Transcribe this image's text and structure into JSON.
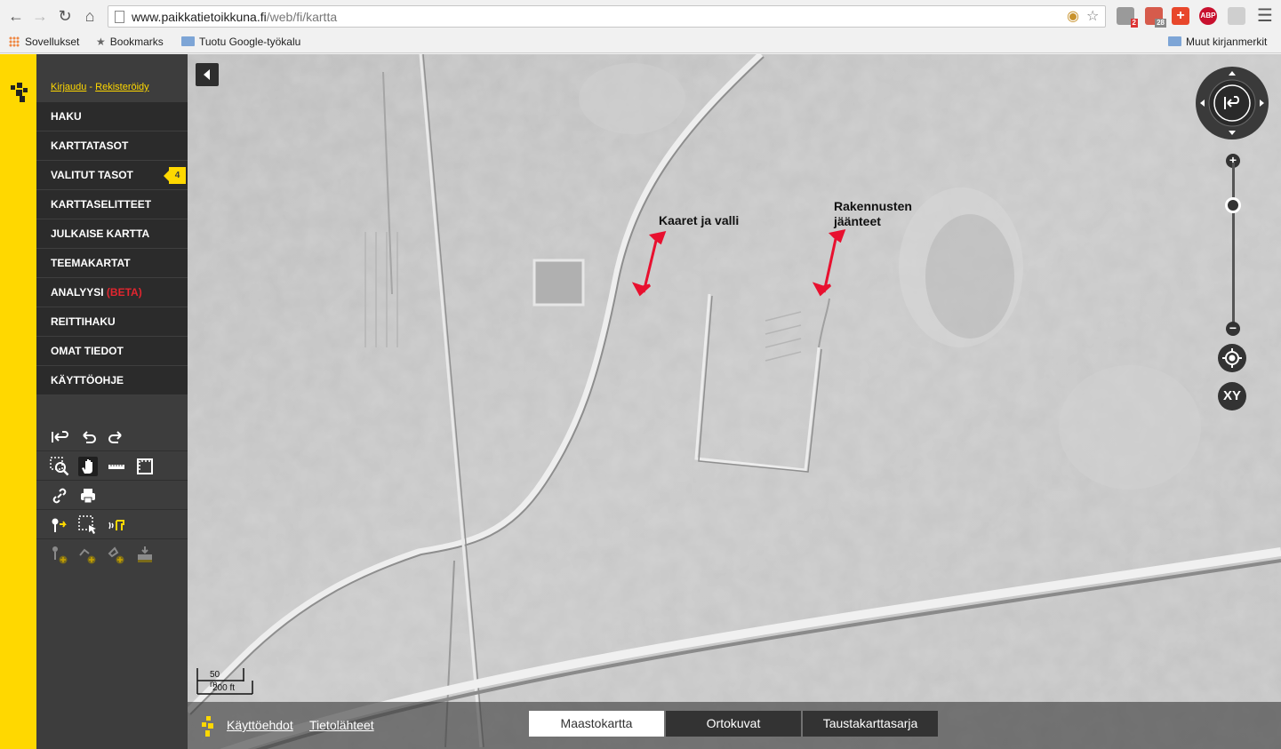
{
  "browser": {
    "url_domain": "www.paikkatietoikkuna.fi",
    "url_path": "/web/fi/kartta",
    "icons": [
      "back-arrow-icon",
      "forward-arrow-icon",
      "reload-icon",
      "home-icon",
      "star-icon",
      "menu-icon"
    ],
    "extensions": {
      "badge_2": "2",
      "badge_28": "28",
      "abp_label": "ABP",
      "plus_label": "+"
    },
    "bookmarks": {
      "apps": "Sovellukset",
      "bookmarks": "Bookmarks",
      "import": "Tuotu Google-työkalu",
      "other": "Muut kirjanmerkit"
    }
  },
  "sidebar": {
    "login": "Kirjaudu",
    "separator": "-",
    "register": "Rekisteröidy",
    "menu": [
      {
        "label": "HAKU"
      },
      {
        "label": "KARTTATASOT"
      },
      {
        "label": "VALITUT TASOT",
        "badge": "4"
      },
      {
        "label": "KARTTASELITTEET"
      },
      {
        "label": "JULKAISE KARTTA"
      },
      {
        "label": "TEEMAKARTAT"
      },
      {
        "label": "ANALYYSI",
        "suffix": "(BETA)"
      },
      {
        "label": "REITTIHAKU"
      },
      {
        "label": "OMAT TIEDOT"
      },
      {
        "label": "KÄYTTÖOHJE"
      }
    ]
  },
  "map": {
    "annotations": {
      "left": "Kaaret ja valli",
      "right_line1": "Rakennusten",
      "right_line2": "jäänteet"
    },
    "arrow_color": "#e8102f",
    "scale": {
      "metric": "50 m",
      "imperial": "200 ft"
    },
    "xy_label": "XY",
    "zoom": {
      "plus": "+",
      "minus": "−"
    },
    "footer": {
      "terms": "Käyttöehdot",
      "sources": "Tietolähteet",
      "tabs": [
        {
          "label": "Maastokartta",
          "active": true
        },
        {
          "label": "Ortokuvat",
          "active": false
        },
        {
          "label": "Taustakarttasarja",
          "active": false
        }
      ]
    }
  },
  "colors": {
    "brand_yellow": "#ffd800",
    "sidebar_dark": "#2b2b2b",
    "beta_red": "#e2262f"
  }
}
